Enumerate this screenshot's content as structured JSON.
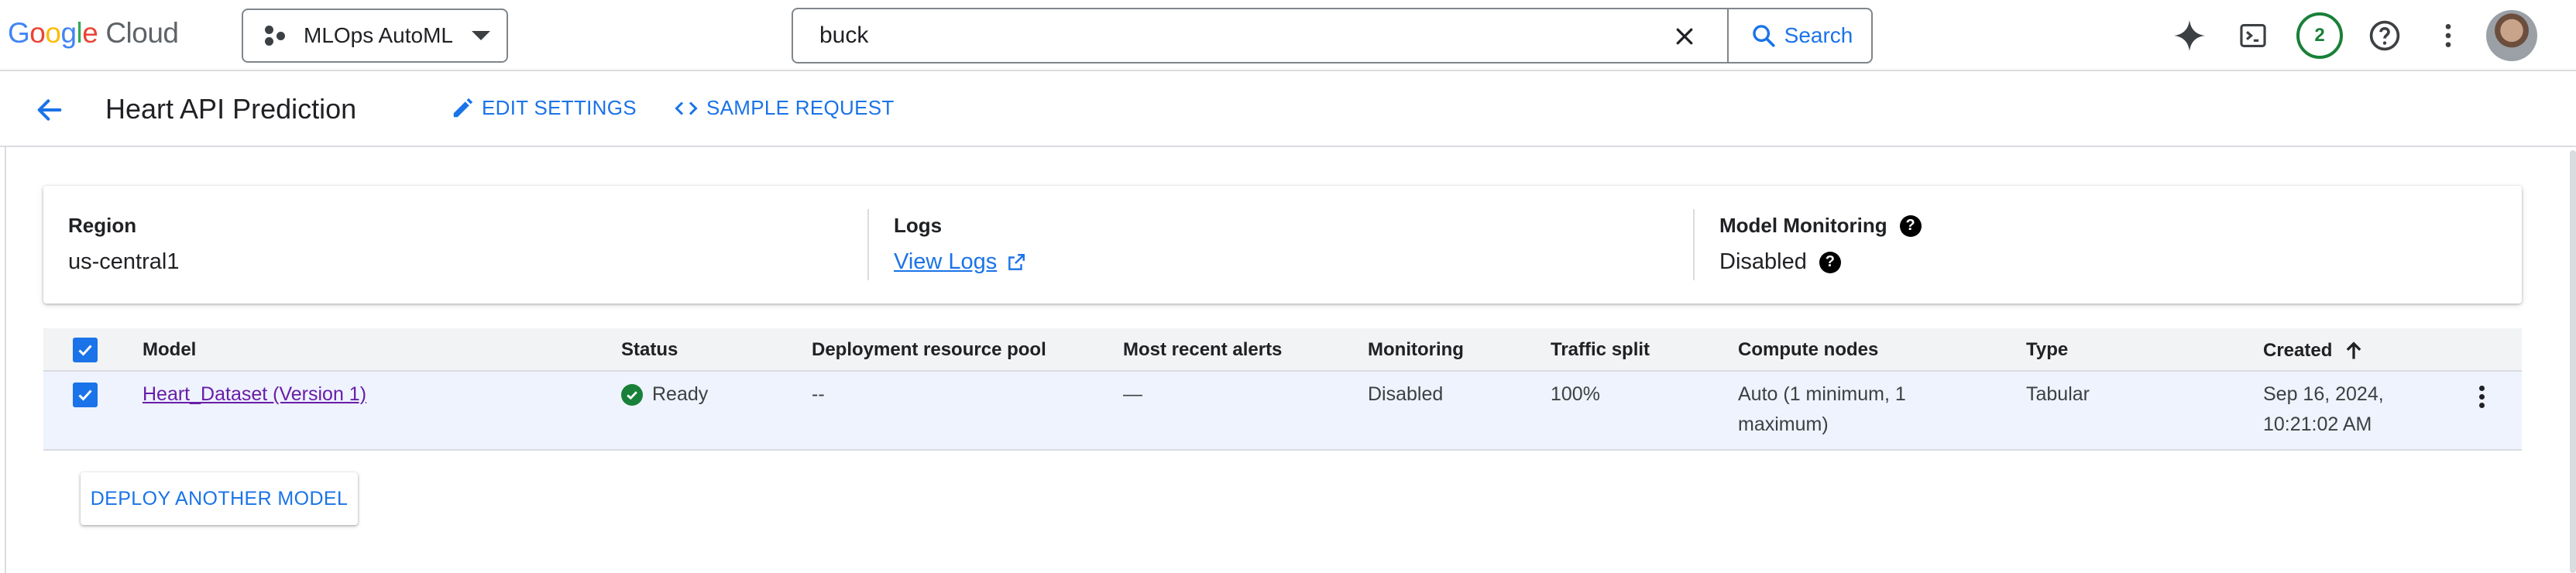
{
  "header": {
    "logo": {
      "letters": [
        "G",
        "o",
        "o",
        "g",
        "l",
        "e"
      ],
      "product": "Cloud"
    },
    "project": {
      "name": "MLOps AutoML"
    },
    "search": {
      "value": "buck",
      "button_label": "Search"
    },
    "notifications": {
      "count": "2"
    },
    "icons": [
      "gemini-icon",
      "cloud-shell-icon",
      "help-icon",
      "more-vert-icon",
      "avatar"
    ]
  },
  "page": {
    "title": "Heart API Prediction",
    "actions": {
      "edit_settings": "EDIT SETTINGS",
      "sample_request": "SAMPLE REQUEST"
    }
  },
  "info_card": {
    "region": {
      "label": "Region",
      "value": "us-central1"
    },
    "logs": {
      "label": "Logs",
      "link_text": "View Logs"
    },
    "monitoring": {
      "label": "Model Monitoring",
      "value": "Disabled"
    }
  },
  "table": {
    "columns": [
      "Model",
      "Status",
      "Deployment resource pool",
      "Most recent alerts",
      "Monitoring",
      "Traffic split",
      "Compute nodes",
      "Type",
      "Created"
    ],
    "sort_column": "Created",
    "rows": [
      {
        "model": "Heart_Dataset (Version 1)",
        "status": "Ready",
        "pool": "--",
        "alerts": "—",
        "monitoring": "Disabled",
        "traffic": "100%",
        "compute_line1": "Auto (1 minimum, 1",
        "compute_line2": "maximum)",
        "type": "Tabular",
        "created_line1": "Sep 16, 2024,",
        "created_line2": "10:21:02 AM",
        "selected": true
      }
    ]
  },
  "deploy_button": "DEPLOY ANOTHER MODEL",
  "colors": {
    "accent": "#1a73e8",
    "ready": "#188038",
    "visited_link": "#681da8",
    "selected_row": "#eef3fd"
  }
}
